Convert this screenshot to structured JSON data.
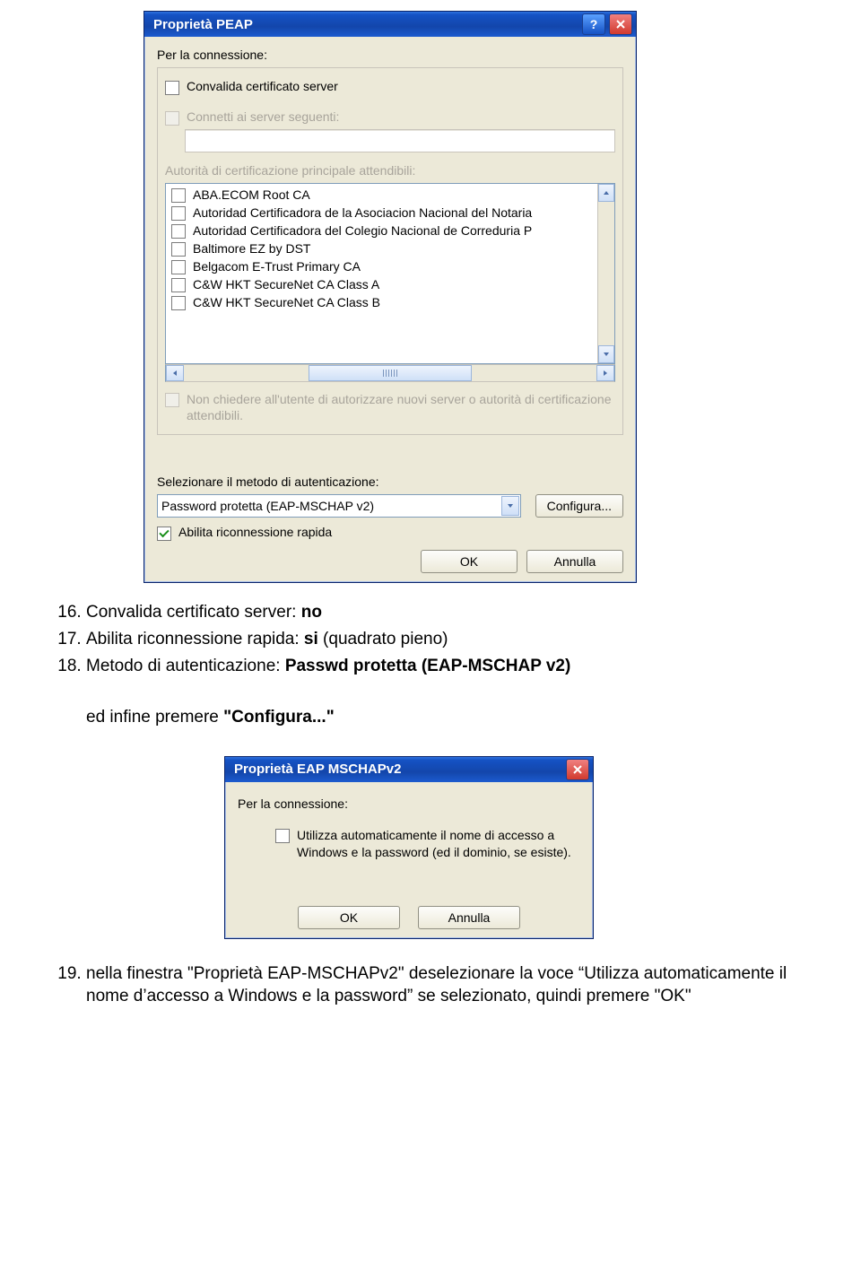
{
  "dialog1": {
    "title": "Proprietà PEAP",
    "section_label": "Per la connessione:",
    "validate_cert": "Convalida certificato server",
    "connect_servers": "Connetti ai server seguenti:",
    "trusted_label": "Autorità di certificazione principale attendibili:",
    "ca_list": [
      "ABA.ECOM Root CA",
      "Autoridad Certificadora de la Asociacion Nacional del Notaria",
      "Autoridad Certificadora del Colegio Nacional de Correduria P",
      "Baltimore EZ by DST",
      "Belgacom E-Trust Primary CA",
      "C&W HKT SecureNet CA Class A",
      "C&W HKT SecureNet CA Class B"
    ],
    "no_prompt": "Non chiedere all'utente di autorizzare nuovi server o autorità di certificazione attendibili.",
    "auth_method_label": "Selezionare il metodo di autenticazione:",
    "auth_method_value": "Password protetta (EAP-MSCHAP v2)",
    "configure_btn": "Configura...",
    "fast_reconnect": "Abilita riconnessione rapida",
    "ok": "OK",
    "cancel": "Annulla"
  },
  "instructions1": {
    "i16_pre": "Convalida certificato server: ",
    "i16_bold": "no",
    "i17_pre": "Abilita riconnessione rapida: ",
    "i17_bold": "si",
    "i17_post": " (quadrato pieno)",
    "i18_pre": "Metodo di autenticazione: ",
    "i18_bold": "Passwd protetta (EAP-MSCHAP v2)",
    "tail_pre": "ed infine premere ",
    "tail_bold": "\"Configura...\""
  },
  "dialog2": {
    "title": "Proprietà EAP MSCHAPv2",
    "section_label": "Per la connessione:",
    "auto_logon": "Utilizza automaticamente il nome di accesso a Windows e la password (ed il dominio, se esiste).",
    "ok": "OK",
    "cancel": "Annulla"
  },
  "instructions2": {
    "text": "nella finestra \"Proprietà EAP-MSCHAPv2\" deselezionare la voce “Utilizza automaticamente il nome d’accesso a Windows e la password” se selezionato, quindi premere \"OK\""
  }
}
